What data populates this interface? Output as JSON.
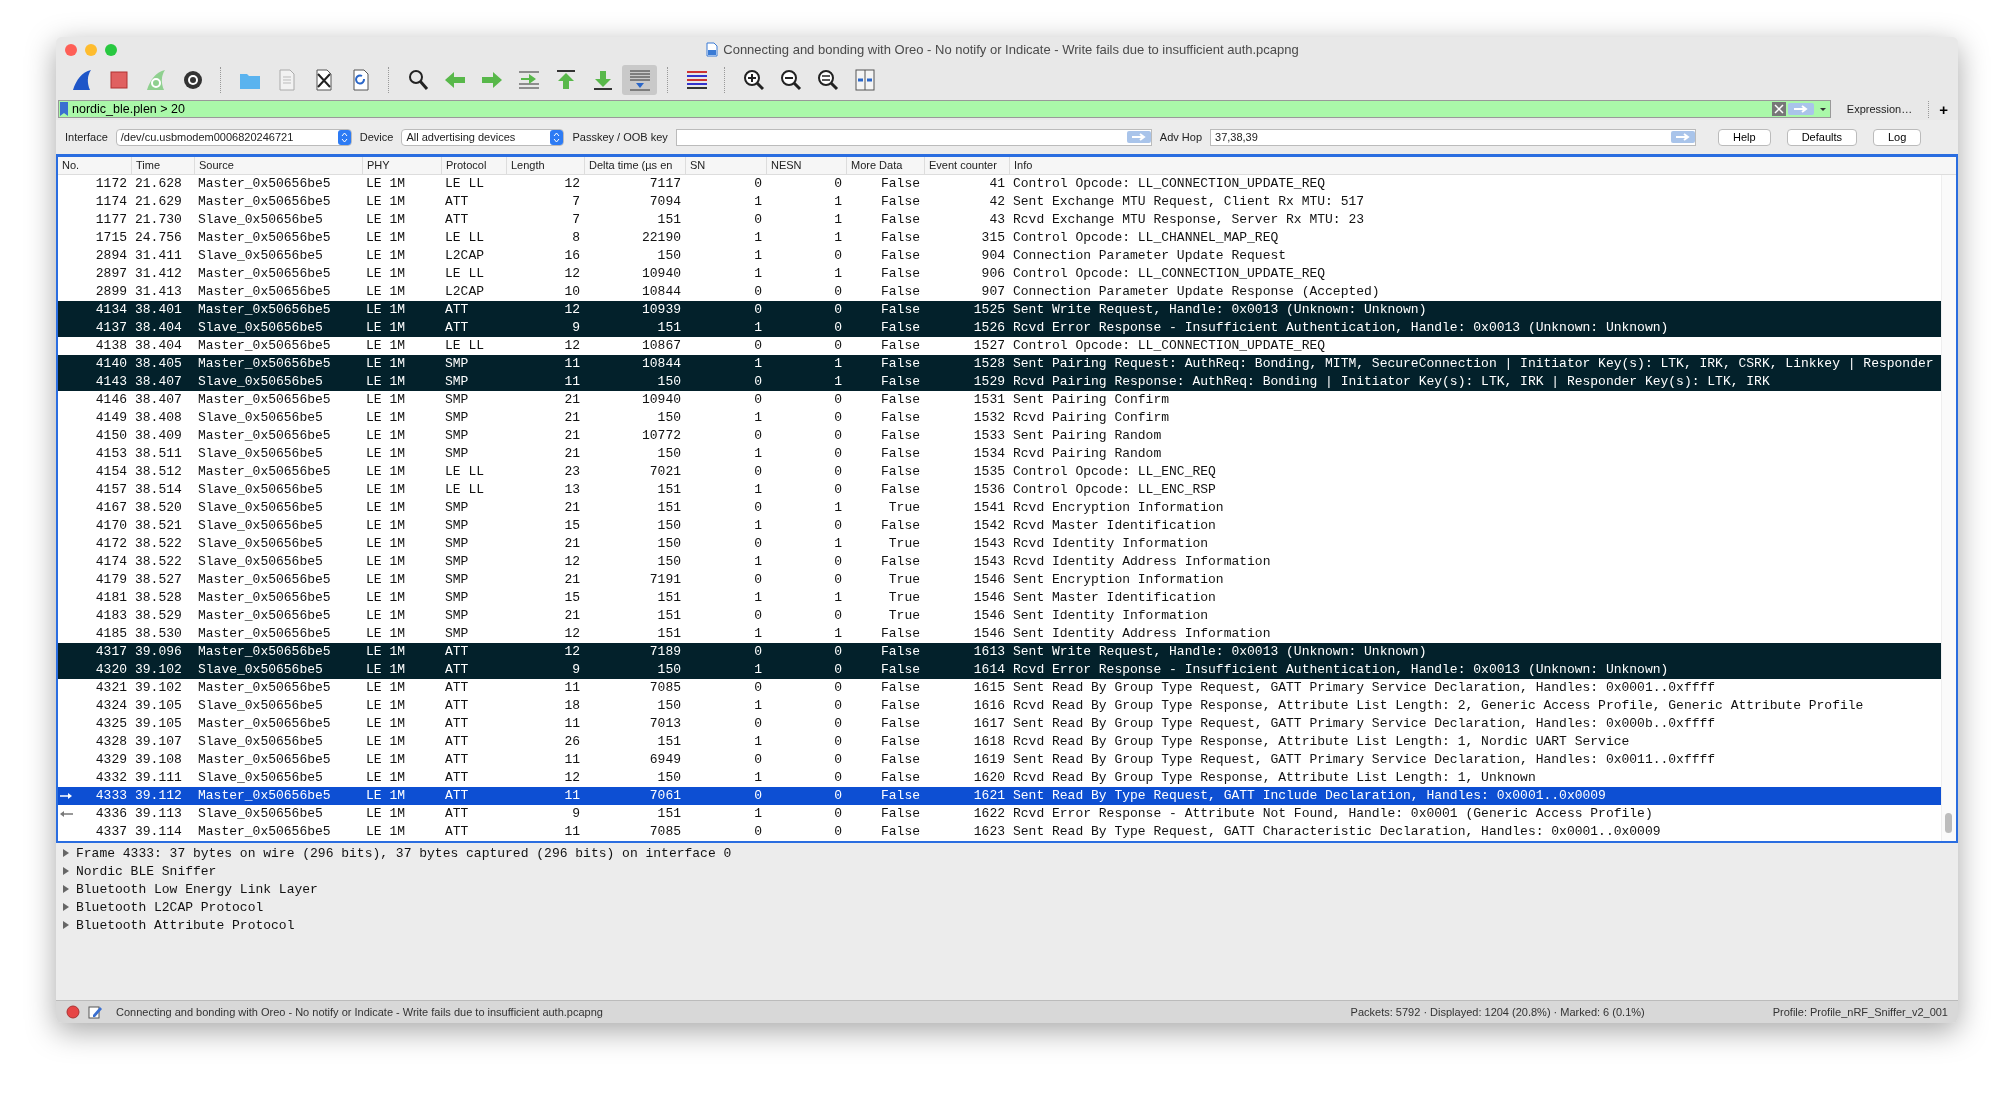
{
  "window": {
    "title": "Connecting and bonding with Oreo - No notify or Indicate - Write fails due to insufficient auth.pcapng"
  },
  "toolbar": [
    {
      "kind": "start",
      "pressed": false
    },
    {
      "kind": "stop",
      "pressed": false
    },
    {
      "kind": "restart",
      "pressed": false
    },
    {
      "kind": "options",
      "pressed": false
    },
    {
      "kind": "separator"
    },
    {
      "kind": "open",
      "pressed": false
    },
    {
      "kind": "save",
      "pressed": false
    },
    {
      "kind": "close",
      "pressed": false
    },
    {
      "kind": "reload",
      "pressed": false
    },
    {
      "kind": "separator"
    },
    {
      "kind": "find",
      "pressed": false
    },
    {
      "kind": "back",
      "pressed": false
    },
    {
      "kind": "forward",
      "pressed": false
    },
    {
      "kind": "goto",
      "pressed": false
    },
    {
      "kind": "first",
      "pressed": false
    },
    {
      "kind": "last",
      "pressed": false
    },
    {
      "kind": "autoscroll",
      "pressed": true
    },
    {
      "kind": "separator"
    },
    {
      "kind": "colorize",
      "pressed": false
    },
    {
      "kind": "separator"
    },
    {
      "kind": "zoom_in",
      "pressed": false
    },
    {
      "kind": "zoom_out",
      "pressed": false
    },
    {
      "kind": "zoom_reset",
      "pressed": false
    },
    {
      "kind": "resize",
      "pressed": false
    }
  ],
  "filter": {
    "value": "nordic_ble.plen > 20",
    "expression_button": "Expression…",
    "add_button": "+"
  },
  "interface_bar": {
    "interface_label": "Interface",
    "interface_value": "/dev/cu.usbmodem0006820246721",
    "device_label": "Device",
    "device_value": "All advertising devices",
    "passkey_label": "Passkey / OOB key",
    "adv_hop_label": "Adv Hop",
    "adv_hop_value": "37,38,39",
    "buttons": [
      "Help",
      "Defaults",
      "Log"
    ]
  },
  "table": {
    "columns": [
      "No.",
      "Time",
      "Source",
      "PHY",
      "Protocol",
      "Length",
      "Delta time (µs en",
      "SN",
      "NESN",
      "More Data",
      "Event counter",
      "Info"
    ],
    "rows": [
      {
        "cells": [
          "1172",
          "21.628",
          "Master_0x50656be5",
          "LE 1M",
          "LE LL",
          "12",
          "7117",
          "0",
          "0",
          "False",
          "41",
          "Control Opcode: LL_CONNECTION_UPDATE_REQ"
        ],
        "marked": false,
        "selected": false
      },
      {
        "cells": [
          "1174",
          "21.629",
          "Master_0x50656be5",
          "LE 1M",
          "ATT",
          "7",
          "7094",
          "1",
          "1",
          "False",
          "42",
          "Sent Exchange MTU Request, Client Rx MTU: 517"
        ],
        "marked": false,
        "selected": false
      },
      {
        "cells": [
          "1177",
          "21.730",
          "Slave_0x50656be5",
          "LE 1M",
          "ATT",
          "7",
          "151",
          "0",
          "1",
          "False",
          "43",
          "Rcvd Exchange MTU Response, Server Rx MTU: 23"
        ],
        "marked": false,
        "selected": false
      },
      {
        "cells": [
          "1715",
          "24.756",
          "Master_0x50656be5",
          "LE 1M",
          "LE LL",
          "8",
          "22190",
          "1",
          "1",
          "False",
          "315",
          "Control Opcode: LL_CHANNEL_MAP_REQ"
        ],
        "marked": false,
        "selected": false
      },
      {
        "cells": [
          "2894",
          "31.411",
          "Slave_0x50656be5",
          "LE 1M",
          "L2CAP",
          "16",
          "150",
          "1",
          "0",
          "False",
          "904",
          "Connection Parameter Update Request"
        ],
        "marked": false,
        "selected": false
      },
      {
        "cells": [
          "2897",
          "31.412",
          "Master_0x50656be5",
          "LE 1M",
          "LE LL",
          "12",
          "10940",
          "1",
          "1",
          "False",
          "906",
          "Control Opcode: LL_CONNECTION_UPDATE_REQ"
        ],
        "marked": false,
        "selected": false
      },
      {
        "cells": [
          "2899",
          "31.413",
          "Master_0x50656be5",
          "LE 1M",
          "L2CAP",
          "10",
          "10844",
          "0",
          "0",
          "False",
          "907",
          "Connection Parameter Update Response (Accepted)"
        ],
        "marked": false,
        "selected": false
      },
      {
        "cells": [
          "4134",
          "38.401",
          "Master_0x50656be5",
          "LE 1M",
          "ATT",
          "12",
          "10939",
          "0",
          "0",
          "False",
          "1525",
          "Sent Write Request, Handle: 0x0013 (Unknown: Unknown)"
        ],
        "marked": true,
        "selected": false
      },
      {
        "cells": [
          "4137",
          "38.404",
          "Slave_0x50656be5",
          "LE 1M",
          "ATT",
          "9",
          "151",
          "1",
          "0",
          "False",
          "1526",
          "Rcvd Error Response - Insufficient Authentication, Handle: 0x0013 (Unknown: Unknown)"
        ],
        "marked": true,
        "selected": false
      },
      {
        "cells": [
          "4138",
          "38.404",
          "Master_0x50656be5",
          "LE 1M",
          "LE LL",
          "12",
          "10867",
          "0",
          "0",
          "False",
          "1527",
          "Control Opcode: LL_CONNECTION_UPDATE_REQ"
        ],
        "marked": false,
        "selected": false
      },
      {
        "cells": [
          "4140",
          "38.405",
          "Master_0x50656be5",
          "LE 1M",
          "SMP",
          "11",
          "10844",
          "1",
          "1",
          "False",
          "1528",
          "Sent Pairing Request: AuthReq: Bonding, MITM, SecureConnection | Initiator Key(s): LTK, IRK, CSRK, Linkkey | Responder"
        ],
        "marked": true,
        "selected": false
      },
      {
        "cells": [
          "4143",
          "38.407",
          "Slave_0x50656be5",
          "LE 1M",
          "SMP",
          "11",
          "150",
          "0",
          "1",
          "False",
          "1529",
          "Rcvd Pairing Response: AuthReq: Bonding | Initiator Key(s): LTK, IRK | Responder Key(s): LTK, IRK"
        ],
        "marked": true,
        "selected": false
      },
      {
        "cells": [
          "4146",
          "38.407",
          "Master_0x50656be5",
          "LE 1M",
          "SMP",
          "21",
          "10940",
          "0",
          "0",
          "False",
          "1531",
          "Sent Pairing Confirm"
        ],
        "marked": false,
        "selected": false
      },
      {
        "cells": [
          "4149",
          "38.408",
          "Slave_0x50656be5",
          "LE 1M",
          "SMP",
          "21",
          "150",
          "1",
          "0",
          "False",
          "1532",
          "Rcvd Pairing Confirm"
        ],
        "marked": false,
        "selected": false
      },
      {
        "cells": [
          "4150",
          "38.409",
          "Master_0x50656be5",
          "LE 1M",
          "SMP",
          "21",
          "10772",
          "0",
          "0",
          "False",
          "1533",
          "Sent Pairing Random"
        ],
        "marked": false,
        "selected": false
      },
      {
        "cells": [
          "4153",
          "38.511",
          "Slave_0x50656be5",
          "LE 1M",
          "SMP",
          "21",
          "150",
          "1",
          "0",
          "False",
          "1534",
          "Rcvd Pairing Random"
        ],
        "marked": false,
        "selected": false
      },
      {
        "cells": [
          "4154",
          "38.512",
          "Master_0x50656be5",
          "LE 1M",
          "LE LL",
          "23",
          "7021",
          "0",
          "0",
          "False",
          "1535",
          "Control Opcode: LL_ENC_REQ"
        ],
        "marked": false,
        "selected": false
      },
      {
        "cells": [
          "4157",
          "38.514",
          "Slave_0x50656be5",
          "LE 1M",
          "LE LL",
          "13",
          "151",
          "1",
          "0",
          "False",
          "1536",
          "Control Opcode: LL_ENC_RSP"
        ],
        "marked": false,
        "selected": false
      },
      {
        "cells": [
          "4167",
          "38.520",
          "Slave_0x50656be5",
          "LE 1M",
          "SMP",
          "21",
          "151",
          "0",
          "1",
          "True",
          "1541",
          "Rcvd Encryption Information"
        ],
        "marked": false,
        "selected": false
      },
      {
        "cells": [
          "4170",
          "38.521",
          "Slave_0x50656be5",
          "LE 1M",
          "SMP",
          "15",
          "150",
          "1",
          "0",
          "False",
          "1542",
          "Rcvd Master Identification"
        ],
        "marked": false,
        "selected": false
      },
      {
        "cells": [
          "4172",
          "38.522",
          "Slave_0x50656be5",
          "LE 1M",
          "SMP",
          "21",
          "150",
          "0",
          "1",
          "True",
          "1543",
          "Rcvd Identity Information"
        ],
        "marked": false,
        "selected": false
      },
      {
        "cells": [
          "4174",
          "38.522",
          "Slave_0x50656be5",
          "LE 1M",
          "SMP",
          "12",
          "150",
          "1",
          "0",
          "False",
          "1543",
          "Rcvd Identity Address Information"
        ],
        "marked": false,
        "selected": false
      },
      {
        "cells": [
          "4179",
          "38.527",
          "Master_0x50656be5",
          "LE 1M",
          "SMP",
          "21",
          "7191",
          "0",
          "0",
          "True",
          "1546",
          "Sent Encryption Information"
        ],
        "marked": false,
        "selected": false
      },
      {
        "cells": [
          "4181",
          "38.528",
          "Master_0x50656be5",
          "LE 1M",
          "SMP",
          "15",
          "151",
          "1",
          "1",
          "True",
          "1546",
          "Sent Master Identification"
        ],
        "marked": false,
        "selected": false
      },
      {
        "cells": [
          "4183",
          "38.529",
          "Master_0x50656be5",
          "LE 1M",
          "SMP",
          "21",
          "151",
          "0",
          "0",
          "True",
          "1546",
          "Sent Identity Information"
        ],
        "marked": false,
        "selected": false
      },
      {
        "cells": [
          "4185",
          "38.530",
          "Master_0x50656be5",
          "LE 1M",
          "SMP",
          "12",
          "151",
          "1",
          "1",
          "False",
          "1546",
          "Sent Identity Address Information"
        ],
        "marked": false,
        "selected": false
      },
      {
        "cells": [
          "4317",
          "39.096",
          "Master_0x50656be5",
          "LE 1M",
          "ATT",
          "12",
          "7189",
          "0",
          "0",
          "False",
          "1613",
          "Sent Write Request, Handle: 0x0013 (Unknown: Unknown)"
        ],
        "marked": true,
        "selected": false
      },
      {
        "cells": [
          "4320",
          "39.102",
          "Slave_0x50656be5",
          "LE 1M",
          "ATT",
          "9",
          "150",
          "1",
          "0",
          "False",
          "1614",
          "Rcvd Error Response - Insufficient Authentication, Handle: 0x0013 (Unknown: Unknown)"
        ],
        "marked": true,
        "selected": false
      },
      {
        "cells": [
          "4321",
          "39.102",
          "Master_0x50656be5",
          "LE 1M",
          "ATT",
          "11",
          "7085",
          "0",
          "0",
          "False",
          "1615",
          "Sent Read By Group Type Request, GATT Primary Service Declaration, Handles: 0x0001..0xffff"
        ],
        "marked": false,
        "selected": false
      },
      {
        "cells": [
          "4324",
          "39.105",
          "Slave_0x50656be5",
          "LE 1M",
          "ATT",
          "18",
          "150",
          "1",
          "0",
          "False",
          "1616",
          "Rcvd Read By Group Type Response, Attribute List Length: 2, Generic Access Profile, Generic Attribute Profile"
        ],
        "marked": false,
        "selected": false
      },
      {
        "cells": [
          "4325",
          "39.105",
          "Master_0x50656be5",
          "LE 1M",
          "ATT",
          "11",
          "7013",
          "0",
          "0",
          "False",
          "1617",
          "Sent Read By Group Type Request, GATT Primary Service Declaration, Handles: 0x000b..0xffff"
        ],
        "marked": false,
        "selected": false
      },
      {
        "cells": [
          "4328",
          "39.107",
          "Slave_0x50656be5",
          "LE 1M",
          "ATT",
          "26",
          "151",
          "1",
          "0",
          "False",
          "1618",
          "Rcvd Read By Group Type Response, Attribute List Length: 1, Nordic UART Service"
        ],
        "marked": false,
        "selected": false
      },
      {
        "cells": [
          "4329",
          "39.108",
          "Master_0x50656be5",
          "LE 1M",
          "ATT",
          "11",
          "6949",
          "0",
          "0",
          "False",
          "1619",
          "Sent Read By Group Type Request, GATT Primary Service Declaration, Handles: 0x0011..0xffff"
        ],
        "marked": false,
        "selected": false
      },
      {
        "cells": [
          "4332",
          "39.111",
          "Slave_0x50656be5",
          "LE 1M",
          "ATT",
          "12",
          "150",
          "1",
          "0",
          "False",
          "1620",
          "Rcvd Read By Group Type Response, Attribute List Length: 1, Unknown"
        ],
        "marked": false,
        "selected": false
      },
      {
        "cells": [
          "4333",
          "39.112",
          "Master_0x50656be5",
          "LE 1M",
          "ATT",
          "11",
          "7061",
          "0",
          "0",
          "False",
          "1621",
          "Sent Read By Type Request, GATT Include Declaration, Handles: 0x0001..0x0009"
        ],
        "marked": false,
        "selected": true,
        "kind": "request"
      },
      {
        "cells": [
          "4336",
          "39.113",
          "Slave_0x50656be5",
          "LE 1M",
          "ATT",
          "9",
          "151",
          "1",
          "0",
          "False",
          "1622",
          "Rcvd Error Response - Attribute Not Found, Handle: 0x0001 (Generic Access Profile)"
        ],
        "marked": false,
        "selected": false,
        "kind": "response"
      },
      {
        "cells": [
          "4337",
          "39.114",
          "Master_0x50656be5",
          "LE 1M",
          "ATT",
          "11",
          "7085",
          "0",
          "0",
          "False",
          "1623",
          "Sent Read By Type Request, GATT Characteristic Declaration, Handles: 0x0001..0x0009"
        ],
        "marked": false,
        "selected": false
      }
    ]
  },
  "details": [
    {
      "label": "Frame 4333: 37 bytes on wire (296 bits), 37 bytes captured (296 bits) on interface 0",
      "expanded": false
    },
    {
      "label": "Nordic BLE Sniffer",
      "expanded": false
    },
    {
      "label": "Bluetooth Low Energy Link Layer",
      "expanded": false
    },
    {
      "label": "Bluetooth L2CAP Protocol",
      "expanded": false
    },
    {
      "label": "Bluetooth Attribute Protocol",
      "expanded": false
    }
  ],
  "status_bar": {
    "file": "Connecting and bonding with Oreo - No notify or Indicate - Write fails due to insufficient auth.pcapng",
    "packets": "Packets: 5792 · Displayed: 1204 (20.8%) · Marked: 6 (0.1%)",
    "profile": "Profile: Profile_nRF_Sniffer_v2_001"
  }
}
